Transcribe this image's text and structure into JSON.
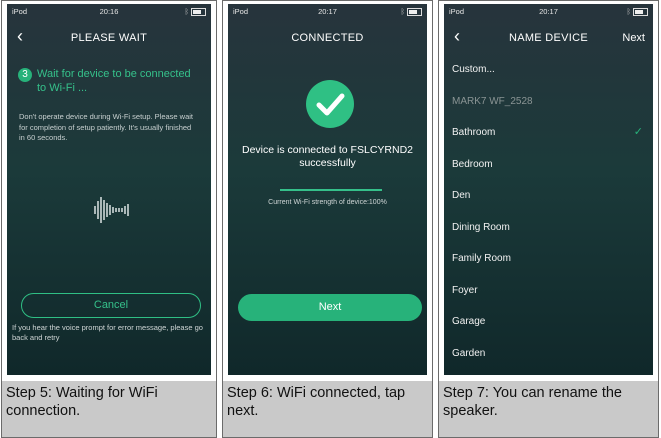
{
  "panel1": {
    "status": {
      "carrier": "iPod",
      "time": "20:16"
    },
    "title": "PLEASE WAIT",
    "step_number": "3",
    "step_text": "Wait for device to be connected to Wi-Fi ...",
    "note": "Don't operate device during Wi-Fi setup. Please wait for completion of setup patiently. It's usually finished in 60 seconds.",
    "cancel_label": "Cancel",
    "error_message": "If you hear the voice prompt for error message, please go back and retry",
    "caption": "Step 5: Waiting for WiFi connection."
  },
  "panel2": {
    "status": {
      "carrier": "iPod",
      "time": "20:17"
    },
    "title": "CONNECTED",
    "message": "Device is connected to FSLCYRND2 successfully",
    "strength_text": "Current Wi-Fi strength of device:100%",
    "strength_percent": 100,
    "next_label": "Next",
    "caption": "Step 6: WiFi connected, tap next."
  },
  "panel3": {
    "status": {
      "carrier": "iPod",
      "time": "20:17"
    },
    "title": "NAME DEVICE",
    "next_label": "Next",
    "items": [
      {
        "label": "Custom..."
      },
      {
        "label": "MARK7 WF_2528"
      },
      {
        "label": "Bathroom"
      },
      {
        "label": "Bedroom"
      },
      {
        "label": "Den"
      },
      {
        "label": "Dining Room"
      },
      {
        "label": "Family Room"
      },
      {
        "label": "Foyer"
      },
      {
        "label": "Garage"
      },
      {
        "label": "Garden"
      }
    ],
    "selected_index": 2,
    "caption": "Step 7: You can rename the speaker."
  },
  "colors": {
    "accent": "#27b27a",
    "caption_bg": "#c9c9c9",
    "screen_bg": "#1b3a3a"
  }
}
